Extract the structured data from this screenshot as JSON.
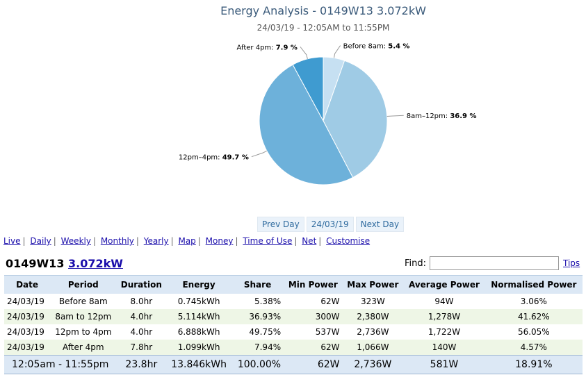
{
  "chart_data": {
    "type": "pie",
    "title": "Energy Analysis - 0149W13 3.072kW",
    "subtitle": "24/03/19 - 12:05AM to 11:55PM",
    "slices": [
      {
        "label": "Before 8am",
        "value": 5.4,
        "display": "5.4 %",
        "color": "#c6e0f2"
      },
      {
        "label": "8am–12pm",
        "value": 36.9,
        "display": "36.9 %",
        "color": "#9fcbe5"
      },
      {
        "label": "12pm–4pm",
        "value": 49.7,
        "display": "49.7 %",
        "color": "#6db1da"
      },
      {
        "label": "After 4pm",
        "value": 7.9,
        "display": "7.9 %",
        "color": "#3f9bd0"
      }
    ]
  },
  "daynav": {
    "prev": "Prev Day",
    "date": "24/03/19",
    "next": "Next Day"
  },
  "nav": {
    "links": [
      "Live",
      "Daily",
      "Weekly",
      "Monthly",
      "Yearly",
      "Map",
      "Money",
      "Time of Use",
      "Net",
      "Customise"
    ]
  },
  "heading": {
    "device": "0149W13",
    "power": "3.072kW"
  },
  "find": {
    "label": "Find:",
    "value": "",
    "tips": "Tips"
  },
  "table": {
    "headers": [
      "Date",
      "Period",
      "Duration",
      "Energy",
      "Share",
      "Min Power",
      "Max Power",
      "Average Power",
      "Normalised Power"
    ],
    "rows": [
      [
        "24/03/19",
        "Before 8am",
        "8.0hr",
        "0.745kWh",
        "5.38%",
        "62W",
        "323W",
        "94W",
        "3.06%"
      ],
      [
        "24/03/19",
        "8am to 12pm",
        "4.0hr",
        "5.114kWh",
        "36.93%",
        "300W",
        "2,380W",
        "1,278W",
        "41.62%"
      ],
      [
        "24/03/19",
        "12pm to 4pm",
        "4.0hr",
        "6.888kWh",
        "49.75%",
        "537W",
        "2,736W",
        "1,722W",
        "56.05%"
      ],
      [
        "24/03/19",
        "After 4pm",
        "7.8hr",
        "1.099kWh",
        "7.94%",
        "62W",
        "1,066W",
        "140W",
        "4.57%"
      ]
    ],
    "total": [
      "12:05am - 11:55pm",
      "23.8hr",
      "13.846kWh",
      "100.00%",
      "62W",
      "2,736W",
      "581W",
      "18.91%"
    ]
  }
}
